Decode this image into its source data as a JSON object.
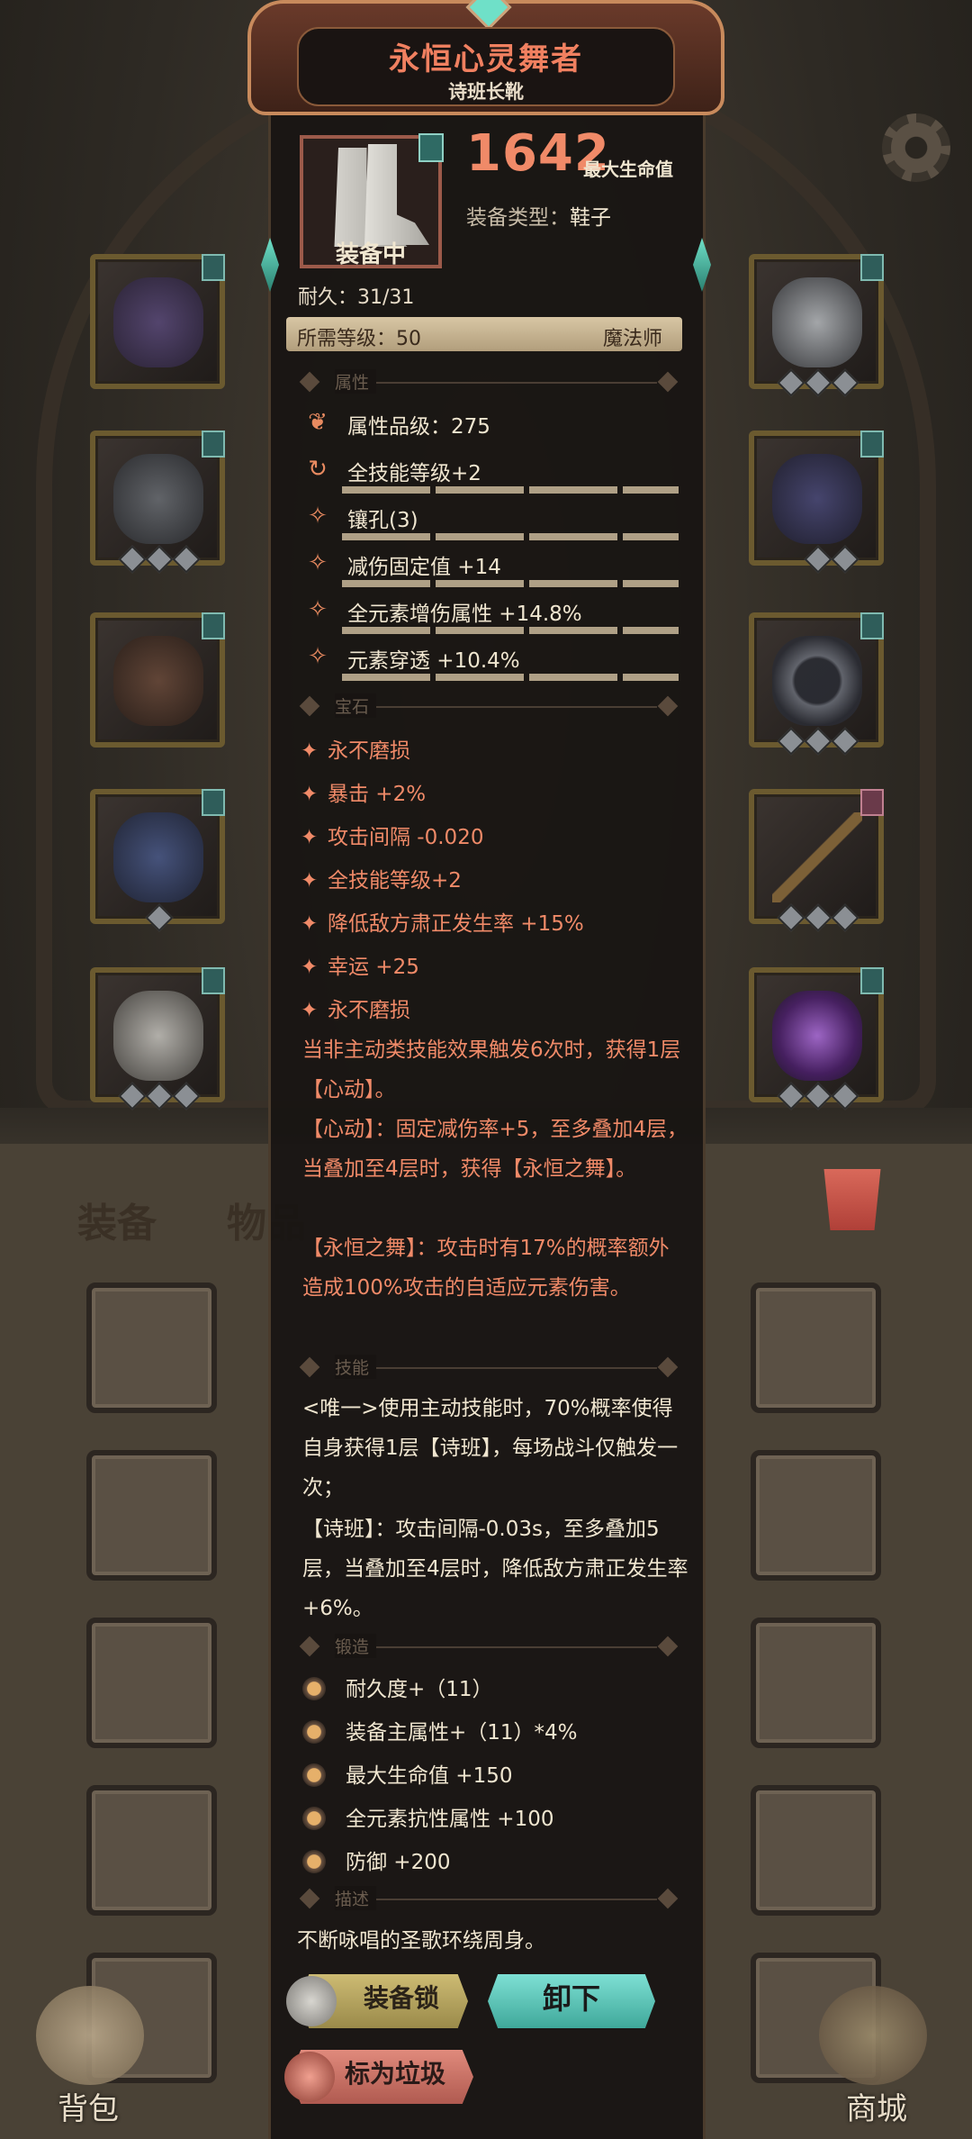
{
  "item": {
    "name": "永恒心灵舞者",
    "subtitle": "诗班长靴",
    "max_hp_value": "1642",
    "max_hp_label": "最大生命值",
    "type_label": "装备类型：",
    "type_value": "鞋子",
    "equipped_tag": "装备中",
    "durability": "耐久：31/31",
    "required_level": "所需等级：50",
    "class_name": "魔法师"
  },
  "sections": {
    "attributes": "属性",
    "gems": "宝石",
    "skills": "技能",
    "forge": "锻造",
    "description": "描述"
  },
  "attributes": [
    {
      "icon": "quality-icon",
      "text": "属性品级：275"
    },
    {
      "icon": "cycle-icon",
      "text": "全技能等级+2"
    },
    {
      "icon": "socket-icon",
      "text": "镶孔(3)"
    },
    {
      "icon": "socket-icon",
      "text": "减伤固定值 +14"
    },
    {
      "icon": "socket-icon",
      "text": "全元素增伤属性 +14.8%"
    },
    {
      "icon": "socket-icon",
      "text": "元素穿透 +10.4%"
    }
  ],
  "gems": [
    "永不磨损",
    "暴击 +2%",
    "攻击间隔 -0.020",
    "全技能等级+2",
    "降低敌方肃正发生率 +15%",
    "幸运 +25",
    "永不磨损"
  ],
  "gem_effect": [
    "当非主动类技能效果触发6次时，获得1层【心动】。",
    "【心动】：固定减伤率+5，至多叠加4层，当叠加至4层时，获得【永恒之舞】。",
    "【永恒之舞】：攻击时有17%的概率额外造成100%攻击的自适应元素伤害。"
  ],
  "skill_text": [
    "<唯一>使用主动技能时，70%概率使得自身获得1层【诗班】，每场战斗仅触发一次；",
    "【诗班】：攻击间隔-0.03s，至多叠加5层，当叠加至4层时，降低敌方肃正发生率+6%。"
  ],
  "forge": [
    "耐久度+（11）",
    "装备主属性+（11）*4%",
    "最大生命值 +150",
    "全元素抗性属性 +100",
    "防御 +200"
  ],
  "description": "不断咏唱的圣歌环绕周身。",
  "buttons": {
    "lock": "装备锁",
    "unequip": "卸下",
    "mark_junk": "标为垃圾"
  },
  "background": {
    "tab_equip": "装备",
    "tab_items": "物品",
    "nav_bag": "背包",
    "nav_shop": "商城"
  },
  "colors": {
    "accent_red": "#f08a68",
    "panel_bg": "#181412",
    "teal": "#6fe0c8"
  }
}
